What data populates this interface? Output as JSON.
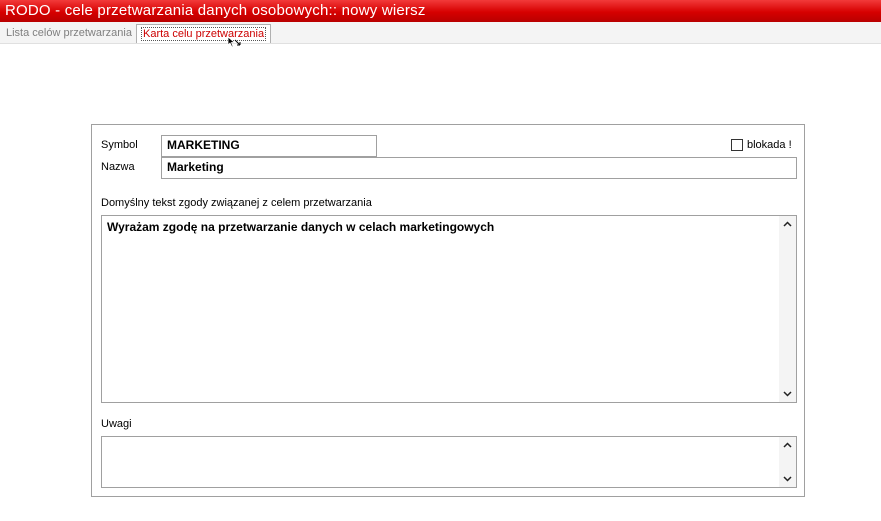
{
  "window": {
    "title": "RODO - cele przetwarzania danych osobowych:: nowy wiersz"
  },
  "tabs": [
    {
      "label": "Lista celów przetwarzania"
    },
    {
      "label": "Karta celu przetwarzania"
    }
  ],
  "form": {
    "symbol_label": "Symbol",
    "symbol_value": "MARKETING",
    "name_label": "Nazwa",
    "name_value": "Marketing",
    "lock_label": "blokada !",
    "lock_checked": false,
    "consent_label": "Domyślny tekst zgody związanej z celem przetwarzania",
    "consent_value": "Wyrażam zgodę na przetwarzanie danych w celach marketingowych",
    "notes_label": "Uwagi",
    "notes_value": ""
  },
  "icons": {
    "scroll_up": "chevron-up-icon",
    "scroll_down": "chevron-down-icon",
    "cursor": "mouse-cursor-icon"
  },
  "colors": {
    "titlebar": "#d60000",
    "active_tab_text": "#cc0000",
    "inactive_tab_text": "#808080"
  }
}
